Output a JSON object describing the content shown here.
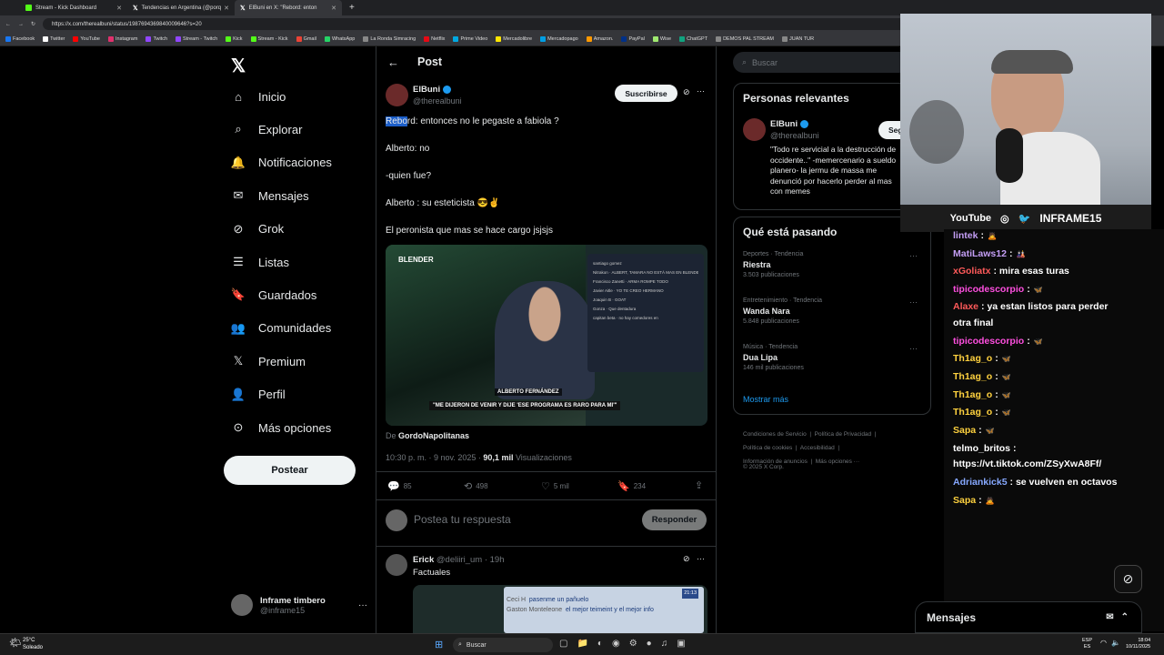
{
  "browser": {
    "tabs": [
      {
        "label": "Stream - Kick Dashboard",
        "icon": "kick-icon"
      },
      {
        "label": "Tendencias en Argentina (@porq",
        "icon": "x-icon"
      },
      {
        "label": "ElBuni en X: \"Rebord: enton",
        "icon": "x-icon"
      }
    ],
    "url": "https://x.com/therealbuni/status/1987694369840009646?s=20",
    "bookmarks": [
      "Facebook",
      "Twitter",
      "YouTube",
      "Instagram",
      "Twitch",
      "Stream - Twitch",
      "Kick",
      "Stream - Kick",
      "Gmail",
      "WhatsApp",
      "La Ronda Simracing",
      "Netflix",
      "Prime Video",
      "Mercadolibre",
      "Mercadopago",
      "Amazon.",
      "PayPal",
      "Wise",
      "ChatGPT",
      "DEMOS PAL STREAM",
      "JUAN TUR"
    ]
  },
  "nav": {
    "items": [
      "Inicio",
      "Explorar",
      "Notificaciones",
      "Mensajes",
      "Grok",
      "Listas",
      "Guardados",
      "Comunidades",
      "Premium",
      "Perfil",
      "Más opciones"
    ],
    "post_button": "Postear",
    "account_name": "Inframe timbero",
    "account_handle": "@inframe15"
  },
  "post": {
    "header": "Post",
    "author": "ElBuni",
    "handle": "@therealbuni",
    "subscribe": "Suscribirse",
    "lines": [
      "Rebord: entonces no le pegaste a fabiola ?",
      "Alberto: no",
      "-quien fue?",
      "Alberto : su esteticista 😎✌️",
      "El peronista que mas se hace cargo jsjsjs"
    ],
    "video": {
      "badge": "BLENDER",
      "lower_third": "ALBERTO FERNÁNDEZ",
      "caption": "\"ME DIJERON DE VENIR Y DIJE 'ESE PROGRAMA ES RARO PARA MI'\"",
      "overlay_chat": [
        "santiago gomez",
        "Nitrakon · ALBERT, TAMARA NO ESTÁ MAS EN BLENDER",
        "Francisco Zanetti · ARMA ROMPE TODO",
        "Javier Aitle · YO TE CREO HERMANO",
        "Joaquin B · GOAT",
        "Gonza · Que dentadura",
        "capitan beta · no hay comedores en"
      ]
    },
    "source_prefix": "De",
    "source": "GordoNapolitanas",
    "time": "10:30 p. m. · 9 nov. 2025 ·",
    "views": "90,1 mil",
    "views_label": "Visualizaciones",
    "stats": {
      "replies": "85",
      "reposts": "498",
      "likes": "5 mil",
      "bookmarks": "234"
    },
    "reply_placeholder": "Postea tu respuesta",
    "reply_button": "Responder"
  },
  "reply": {
    "author": "Erick",
    "handle": "@deliiri_um · 19h",
    "text": "Factuales",
    "media_chat": [
      {
        "name": "Ceci H",
        "msg": "pasenme un pañuelo"
      },
      {
        "name": "Gaston Monteleone",
        "msg": "el mejor teimeint y el mejor info"
      }
    ],
    "media_time": "21:13"
  },
  "right": {
    "search_placeholder": "Buscar",
    "relevant_title": "Personas relevantes",
    "relevant_name": "ElBuni",
    "relevant_handle": "@therealbuni",
    "follow": "Seg",
    "relevant_bio": "\"Todo re servicial a la destrucción de occidente..\" -memercenario a sueldo planero- la jermu de massa me denunció por hacerlo perder al mas con memes",
    "trending_title": "Qué está pasando",
    "trends": [
      {
        "cat": "Deportes · Tendencia",
        "name": "Riestra",
        "count": "3.503 publicaciones"
      },
      {
        "cat": "Entretenimiento · Tendencia",
        "name": "Wanda Nara",
        "count": "5.848 publicaciones"
      },
      {
        "cat": "Música · Tendencia",
        "name": "Dua Lipa",
        "count": "146 mil publicaciones"
      }
    ],
    "show_more": "Mostrar más",
    "footer": [
      "Condiciones de Servicio",
      "Política de Privacidad",
      "Política de cookies",
      "Accesibilidad",
      "Información de anuncios",
      "Más opciones ···",
      "© 2025 X Corp."
    ]
  },
  "webcam": {
    "socials": [
      "YouTube",
      "INFRAME15"
    ]
  },
  "chat": [
    {
      "user": "lintek",
      "color": "#c49ef5",
      "msg": ":",
      "emote": "🙇"
    },
    {
      "user": "MatiLaws12",
      "color": "#c49ef5",
      "msg": ":",
      "emote": "🎎"
    },
    {
      "user": "xGoliatx",
      "color": "#ff5a5a",
      "msg": ": mira esas turas",
      "emote": ""
    },
    {
      "user": "tipicodescorpio",
      "color": "#ff4fe0",
      "msg": ":",
      "emote": "🦋"
    },
    {
      "user": "Alaxe",
      "color": "#ff5a5a",
      "msg": ": ya estan listos para perder",
      "emote": ""
    },
    {
      "user": "",
      "color": "#ffffff",
      "msg": "otra final",
      "emote": ""
    },
    {
      "user": "tipicodescorpio",
      "color": "#ff4fe0",
      "msg": ":",
      "emote": "🦋"
    },
    {
      "user": "Th1ag_o",
      "color": "#ffd23f",
      "msg": ":",
      "emote": "🦋"
    },
    {
      "user": "Th1ag_o",
      "color": "#ffd23f",
      "msg": ":",
      "emote": "🦋"
    },
    {
      "user": "Th1ag_o",
      "color": "#ffd23f",
      "msg": ":",
      "emote": "🦋"
    },
    {
      "user": "Th1ag_o",
      "color": "#ffd23f",
      "msg": ":",
      "emote": "🦋"
    },
    {
      "user": "Sapa",
      "color": "#ffd23f",
      "msg": ":",
      "emote": "🦋"
    },
    {
      "user": "telmo_britos",
      "color": "#ffffff",
      "msg": ":",
      "emote": ""
    },
    {
      "user": "",
      "color": "#ffffff",
      "msg": "https://vt.tiktok.com/ZSyXwA8Ff/",
      "emote": ""
    },
    {
      "user": "Adriankick5",
      "color": "#86a8ff",
      "msg": ": se vuelven en octavos",
      "emote": ""
    },
    {
      "user": "Sapa",
      "color": "#ffd23f",
      "msg": ":",
      "emote": "🙇"
    }
  ],
  "messages_title": "Mensajes",
  "taskbar": {
    "weather_temp": "25°C",
    "weather_desc": "Soleado",
    "search": "Buscar",
    "lang": "ESP",
    "lang2": "ES",
    "time": "18:04",
    "date": "10/11/2025"
  }
}
